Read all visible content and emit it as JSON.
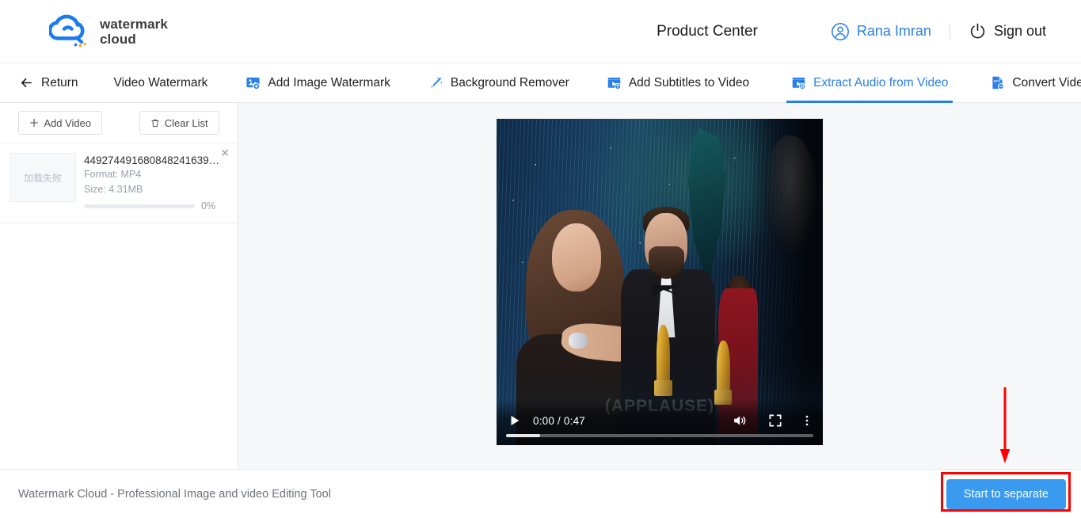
{
  "brand": {
    "name_line1": "watermark",
    "name_line2": "cloud",
    "accent_color": "#2a7fe8"
  },
  "header": {
    "product_center": "Product Center",
    "user_name": "Rana Imran",
    "sign_out": "Sign out"
  },
  "nav": {
    "items": [
      {
        "label": "Return",
        "icon": "arrow-left-icon",
        "active": false
      },
      {
        "label": "Video Watermark",
        "icon": "none",
        "active": false
      },
      {
        "label": "Add Image Watermark",
        "icon": "image-plus-icon",
        "active": false
      },
      {
        "label": "Background Remover",
        "icon": "magic-wand-icon",
        "active": false
      },
      {
        "label": "Add Subtitles to Video",
        "icon": "video-subtitle-icon",
        "active": false
      },
      {
        "label": "Extract Audio from Video",
        "icon": "video-audio-icon",
        "active": true
      },
      {
        "label": "Convert Video Format",
        "icon": "mp4-file-icon",
        "active": false
      }
    ]
  },
  "sidebar": {
    "add_video_label": "Add Video",
    "clear_list_label": "Clear List",
    "files": [
      {
        "name": "449274491680848241639....",
        "format_label": "Format:",
        "format_value": "MP4",
        "size_label": "Size:",
        "size_value": "4.31MB",
        "progress_percent": 0,
        "progress_label": "0%",
        "thumbnail_text": "加载失败",
        "close_glyph": "✕"
      }
    ]
  },
  "player": {
    "current_time": "0:00",
    "duration": "0:47",
    "time_display": "0:00 / 0:47",
    "subtitle_overlay": "(APPLAUSE)",
    "progress_percent": 11
  },
  "footer": {
    "text": "Watermark Cloud - Professional Image and video Editing Tool",
    "primary_button": "Start to separate"
  },
  "annotations": {
    "arrow_color": "#ff0000",
    "box_color": "#ff0000"
  }
}
